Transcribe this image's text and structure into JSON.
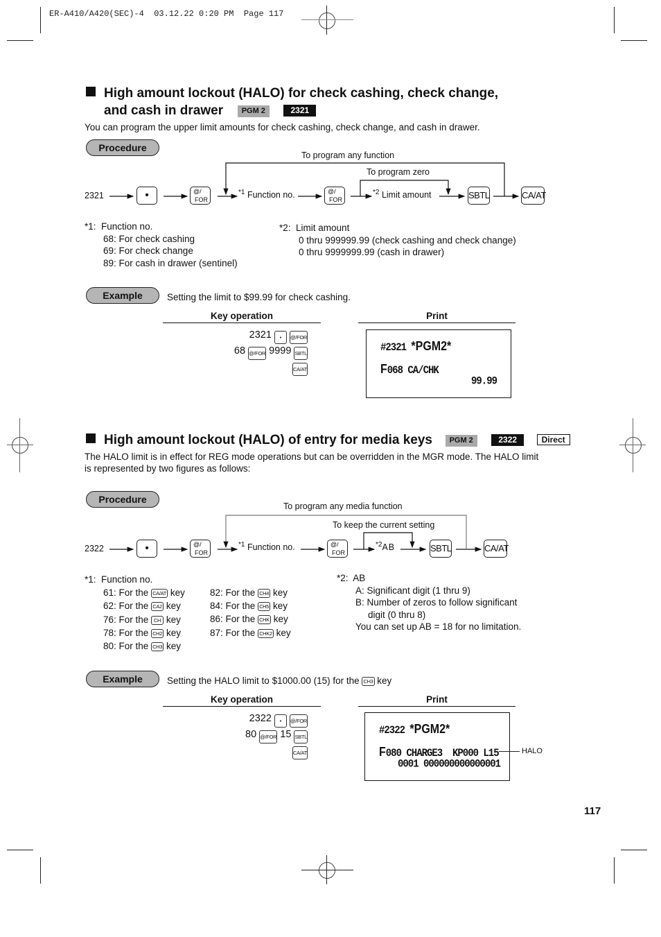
{
  "page_header": "ER-A410/A420(SEC)-4  03.12.22 0:20 PM  Page 117",
  "page_number": "117",
  "section1": {
    "title_line1": "High amount lockout (HALO) for check cashing, check change,",
    "title_line2": "and cash in drawer",
    "mode_tag": "PGM 2",
    "code_tag": "2321",
    "description": "You can program the upper limit amounts for check cashing, check change, and cash in drawer.",
    "procedure_label": "Procedure",
    "flow": {
      "start": "2321",
      "loop_label": "To program any function",
      "skip_label": "To program zero",
      "step1_mark": "*1",
      "step1": "Function no.",
      "step2_mark": "*2",
      "step2": "Limit amount",
      "keys": {
        "dot": "•",
        "at_top": "@/",
        "at_bottom": "FOR",
        "sbtl": "SBTL",
        "caat": "CA/AT"
      }
    },
    "note1": {
      "mark": "*1:",
      "title": "Function no.",
      "items": [
        "68: For check cashing",
        "69: For check change",
        "89: For cash in drawer (sentinel)"
      ]
    },
    "note2": {
      "mark": "*2:",
      "title": "Limit amount",
      "items": [
        "0 thru 999999.99 (check cashing and check change)",
        "0 thru 9999999.99 (cash in drawer)"
      ]
    },
    "example_label": "Example",
    "example_text": "Setting the limit to $99.99 for check cashing.",
    "key_operation_label": "Key operation",
    "print_label": "Print",
    "key_operation": {
      "line1_num": "2321",
      "line2_num_a": "68",
      "line2_num_b": "9999",
      "key_dot": "•",
      "key_for": "@/FOR",
      "key_sbtl": "SBTL",
      "key_caat": "CA/AT"
    },
    "receipt": {
      "line1_code": "#2321",
      "line1_mode": "*PGM2*",
      "line2_prefix": "F",
      "line2": "068 CA/CHK",
      "line3": "99.99"
    }
  },
  "section2": {
    "title": "High amount lockout (HALO) of entry for media keys",
    "mode_tag": "PGM 2",
    "code_tag": "2322",
    "direct_tag": "Direct",
    "description_line1": "The HALO limit is in effect for REG mode operations but can be overridden in the MGR mode.  The HALO limit",
    "description_line2": "is represented by two figures as follows:",
    "procedure_label": "Procedure",
    "flow": {
      "start": "2322",
      "loop_label": "To program any media function",
      "skip_label": "To keep the current setting",
      "step1_mark": "*1",
      "step1": "Function no.",
      "step2_mark": "*2",
      "step2": "AB",
      "keys": {
        "dot": "•",
        "at_top": "@/",
        "at_bottom": "FOR",
        "sbtl": "SBTL",
        "caat": "CA/AT"
      }
    },
    "note1": {
      "mark": "*1:",
      "title": "Function no.",
      "items_left": [
        {
          "prefix": "61: For the",
          "key": "CA/AT",
          "suffix": "key"
        },
        {
          "prefix": "62: For the",
          "key": "CA2",
          "suffix": "key"
        },
        {
          "prefix": "76: For the",
          "key": "CH",
          "suffix": "key"
        },
        {
          "prefix": "78: For the",
          "key": "CH2",
          "suffix": "key"
        },
        {
          "prefix": "80: For the",
          "key": "CH3",
          "suffix": "key"
        }
      ],
      "items_right": [
        {
          "prefix": "82: For the",
          "key": "CH4",
          "suffix": "key"
        },
        {
          "prefix": "84: For the",
          "key": "CH5",
          "suffix": "key"
        },
        {
          "prefix": "86: For the",
          "key": "CHK",
          "suffix": "key"
        },
        {
          "prefix": "87: For the",
          "key": "CHK2",
          "suffix": "key"
        }
      ]
    },
    "note2": {
      "mark": "*2:",
      "title": "AB",
      "line_a": "A: Significant digit (1 thru 9)",
      "line_b1": "B: Number of zeros to follow significant",
      "line_b2": "digit (0 thru 8)",
      "line_c": "You can set up AB = 18 for no limitation."
    },
    "example_label": "Example",
    "example_text_prefix": "Setting the HALO limit to $1000.00 (15) for the",
    "example_key": "CH3",
    "example_text_suffix": "key",
    "key_operation_label": "Key operation",
    "print_label": "Print",
    "key_operation": {
      "line1_num": "2322",
      "line2_num_a": "80",
      "line2_num_b": "15",
      "key_dot": "•",
      "key_for": "@/FOR",
      "key_sbtl": "SBTL",
      "key_caat": "CA/AT"
    },
    "receipt": {
      "line1_code": "#2322",
      "line1_mode": "*PGM2*",
      "line2_prefix": "F",
      "line2": "080 CHARGE3  KP000 L15",
      "line3": "0001 000000000000001",
      "callout": "HALO"
    }
  }
}
